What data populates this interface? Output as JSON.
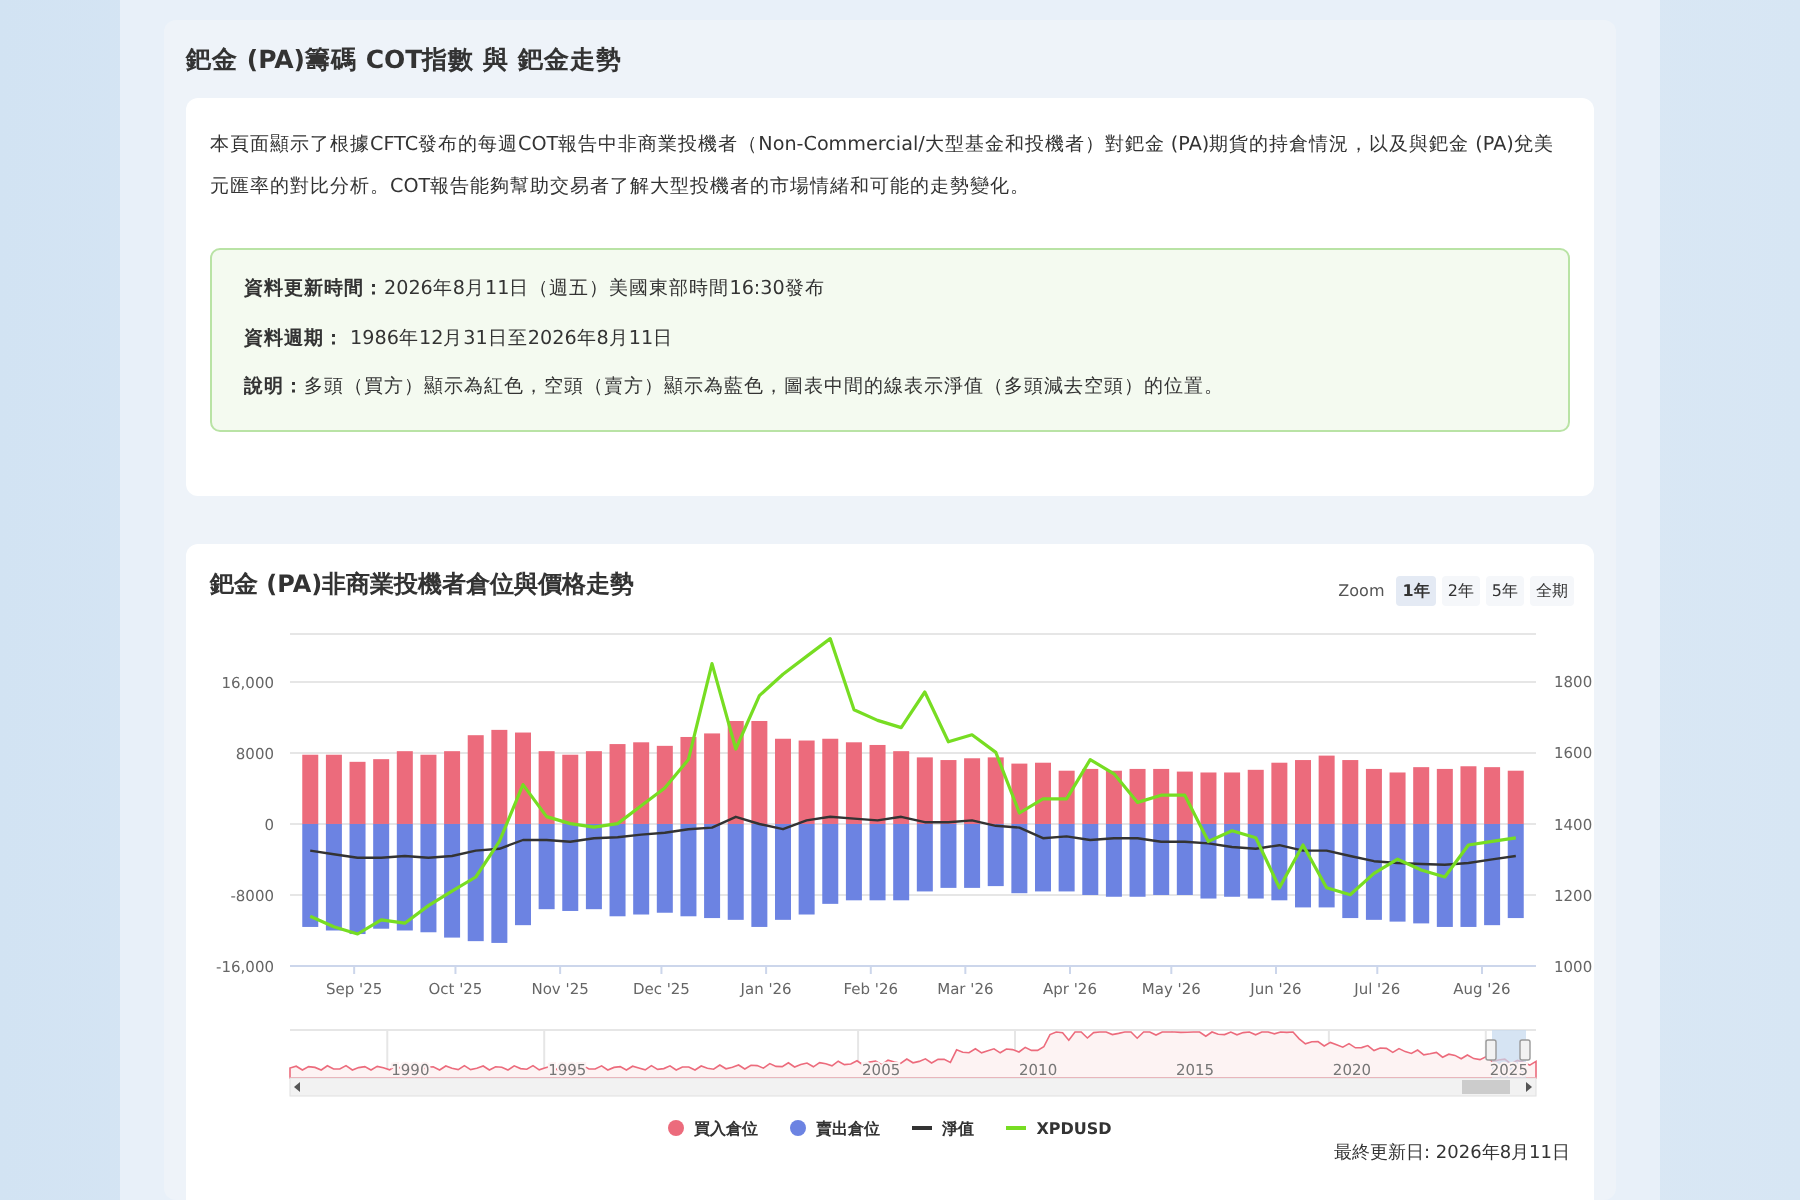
{
  "header": {
    "title": "鈀金 (PA)籌碼 COT指數 與 鈀金走勢"
  },
  "intro": {
    "text": "本頁面顯示了根據CFTC發布的每週COT報告中非商業投機者（Non-Commercial/大型基金和投機者）對鈀金 (PA)期貨的持倉情況，以及與鈀金 (PA)兌美元匯率的對比分析。COT報告能夠幫助交易者了解大型投機者的市場情緒和可能的走勢變化。"
  },
  "info": [
    {
      "label": "資料更新時間：",
      "text": "2026年8月11日（週五）美國東部時間16:30發布"
    },
    {
      "label": "資料週期：",
      "text": " 1986年12月31日至2026年8月11日"
    },
    {
      "label": "說明：",
      "text": "多頭（買方）顯示為紅色，空頭（賣方）顯示為藍色，圖表中間的線表示淨值（多頭減去空頭）的位置。"
    }
  ],
  "chart_card": {
    "title": "鈀金 (PA)非商業投機者倉位與價格走勢",
    "zoom_label": "Zoom",
    "zoom_buttons": [
      {
        "label": "1年",
        "selected": true
      },
      {
        "label": "2年",
        "selected": false
      },
      {
        "label": "5年",
        "selected": false
      },
      {
        "label": "全期",
        "selected": false
      }
    ],
    "chart_data": {
      "type": "bar",
      "stacked": true,
      "grid": true,
      "x": [
        "2025-08-19",
        "2025-08-26",
        "2025-09-02",
        "2025-09-09",
        "2025-09-16",
        "2025-09-23",
        "2025-09-30",
        "2025-10-07",
        "2025-10-14",
        "2025-10-21",
        "2025-10-28",
        "2025-11-04",
        "2025-11-11",
        "2025-11-18",
        "2025-11-25",
        "2025-12-02",
        "2025-12-09",
        "2025-12-16",
        "2025-12-23",
        "2025-12-30",
        "2026-01-06",
        "2026-01-13",
        "2026-01-20",
        "2026-01-27",
        "2026-02-03",
        "2026-02-10",
        "2026-02-17",
        "2026-02-24",
        "2026-03-03",
        "2026-03-10",
        "2026-03-17",
        "2026-03-24",
        "2026-03-31",
        "2026-04-07",
        "2026-04-14",
        "2026-04-21",
        "2026-04-28",
        "2026-05-05",
        "2026-05-12",
        "2026-05-19",
        "2026-05-26",
        "2026-06-02",
        "2026-06-09",
        "2026-06-16",
        "2026-06-23",
        "2026-06-30",
        "2026-07-07",
        "2026-07-14",
        "2026-07-21",
        "2026-07-28",
        "2026-08-04",
        "2026-08-11"
      ],
      "series": [
        {
          "name": "買入倉位",
          "color": "#ec6b7c",
          "type": "bar",
          "values": [
            7800,
            7800,
            7000,
            7300,
            8200,
            7800,
            8200,
            10000,
            10600,
            10300,
            8200,
            7800,
            8200,
            9000,
            9200,
            8800,
            9800,
            10200,
            11600,
            11600,
            9600,
            9400,
            9600,
            9200,
            8900,
            8200,
            7500,
            7200,
            7400,
            7500,
            6800,
            6900,
            6000,
            6200,
            6000,
            6200,
            6200,
            5900,
            5800,
            5800,
            6100,
            6900,
            7200,
            7700,
            7200,
            6200,
            5800,
            6400,
            6200,
            6500,
            6400,
            6000
          ]
        },
        {
          "name": "賣出倉位",
          "color": "#6c83e2",
          "type": "bar",
          "values": [
            -11600,
            -12000,
            -12400,
            -11800,
            -12000,
            -12200,
            -12800,
            -13200,
            -13400,
            -11400,
            -9600,
            -9800,
            -9600,
            -10400,
            -10200,
            -10000,
            -10400,
            -10600,
            -10800,
            -11600,
            -10800,
            -10200,
            -9000,
            -8600,
            -8600,
            -8600,
            -7600,
            -7200,
            -7200,
            -7000,
            -7800,
            -7600,
            -7600,
            -8000,
            -8200,
            -8200,
            -8000,
            -8000,
            -8400,
            -8200,
            -8400,
            -8600,
            -9400,
            -9400,
            -10600,
            -10800,
            -11000,
            -11200,
            -11600,
            -11600,
            -11400,
            -10600
          ]
        },
        {
          "name": "淨值",
          "color": "#333333",
          "type": "line",
          "values": [
            -3000,
            -3400,
            -3800,
            -3800,
            -3600,
            -3800,
            -3600,
            -3000,
            -2800,
            -1800,
            -1800,
            -2000,
            -1600,
            -1500,
            -1200,
            -1000,
            -600,
            -400,
            800,
            0,
            -600,
            400,
            800,
            600,
            400,
            800,
            200,
            200,
            400,
            -200,
            -400,
            -1600,
            -1400,
            -1800,
            -1600,
            -1600,
            -2000,
            -2000,
            -2200,
            -2600,
            -2800,
            -2400,
            -3000,
            -3000,
            -3600,
            -4200,
            -4400,
            -4500,
            -4600,
            -4400,
            -4000,
            -3600
          ]
        },
        {
          "name": "XPDUSD",
          "color": "#77dd22",
          "type": "line",
          "axis": "y2",
          "values": [
            1140,
            1110,
            1090,
            1130,
            1120,
            1170,
            1210,
            1250,
            1350,
            1510,
            1420,
            1400,
            1390,
            1400,
            1450,
            1500,
            1580,
            1850,
            1610,
            1760,
            1820,
            1870,
            1920,
            1720,
            1690,
            1670,
            1770,
            1630,
            1650,
            1600,
            1430,
            1470,
            1470,
            1580,
            1540,
            1460,
            1480,
            1480,
            1350,
            1380,
            1360,
            1220,
            1340,
            1220,
            1200,
            1260,
            1300,
            1270,
            1250,
            1340,
            1350,
            1360
          ]
        }
      ],
      "xlim": [
        "2025-08-13",
        "2026-08-17"
      ],
      "ylim": [
        -16000,
        21400
      ],
      "yticks": [
        {
          "value": -16000,
          "label": "-16,000"
        },
        {
          "value": -8000,
          "label": "-8000"
        },
        {
          "value": 0,
          "label": "0"
        },
        {
          "value": 8000,
          "label": "8000"
        },
        {
          "value": 16000,
          "label": "16,000"
        }
      ],
      "y2lim": [
        1000,
        1933
      ],
      "y2ticks": [
        {
          "value": 1000,
          "label": "1000"
        },
        {
          "value": 1200,
          "label": "1200"
        },
        {
          "value": 1400,
          "label": "1400"
        },
        {
          "value": 1600,
          "label": "1600"
        },
        {
          "value": 1800,
          "label": "1800"
        }
      ],
      "xticks": [
        {
          "value": "2025-09-01",
          "label": "Sep '25"
        },
        {
          "value": "2025-10-01",
          "label": "Oct '25"
        },
        {
          "value": "2025-11-01",
          "label": "Nov '25"
        },
        {
          "value": "2025-12-01",
          "label": "Dec '25"
        },
        {
          "value": "2026-01-01",
          "label": "Jan '26"
        },
        {
          "value": "2026-02-01",
          "label": "Feb '26"
        },
        {
          "value": "2026-03-01",
          "label": "Mar '26"
        },
        {
          "value": "2026-04-01",
          "label": "Apr '26"
        },
        {
          "value": "2026-05-01",
          "label": "May '26"
        },
        {
          "value": "2026-06-01",
          "label": "Jun '26"
        },
        {
          "value": "2026-07-01",
          "label": "Jul '26"
        },
        {
          "value": "2026-08-01",
          "label": "Aug '26"
        }
      ]
    },
    "navigator": {
      "years": [
        {
          "label": "1990"
        },
        {
          "label": "1995"
        },
        {
          "label": "2005"
        },
        {
          "label": "2010"
        },
        {
          "label": "2015"
        },
        {
          "label": "2020"
        },
        {
          "label": "2025"
        }
      ]
    },
    "footer": {
      "text": "最終更新日: 2026年8月11日"
    }
  }
}
